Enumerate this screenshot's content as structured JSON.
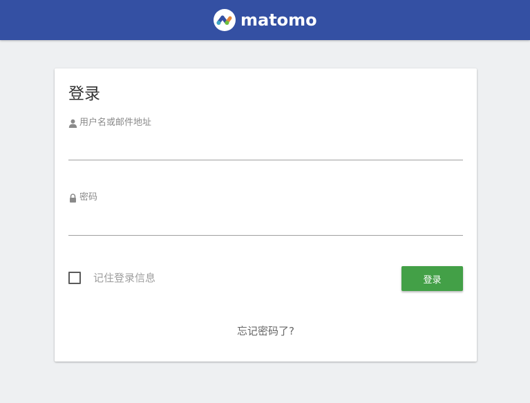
{
  "header": {
    "brand": "matomo",
    "logo_icon": "matomo-logo-icon",
    "background_color": "#3450a3"
  },
  "login_form": {
    "title": "登录",
    "username": {
      "label": "用户名或邮件地址",
      "icon": "user-icon",
      "value": ""
    },
    "password": {
      "label": "密码",
      "icon": "lock-icon",
      "value": ""
    },
    "remember_me": {
      "label": "记住登录信息",
      "checked": false
    },
    "submit_label": "登录",
    "submit_color": "#43a047",
    "forgot_password_label": "忘记密码了?"
  }
}
